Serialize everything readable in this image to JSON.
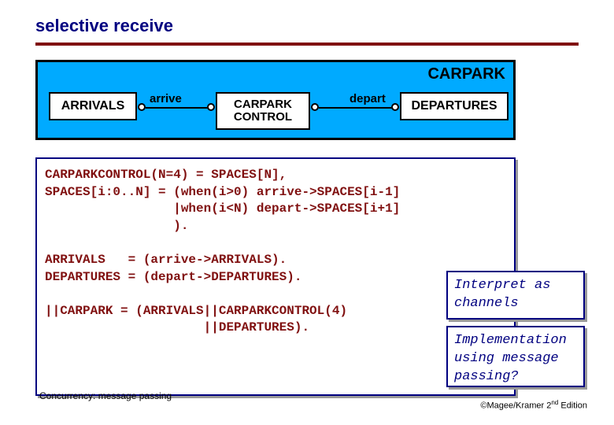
{
  "title": "selective receive",
  "diagram": {
    "system_label": "CARPARK",
    "arrivals": "ARRIVALS",
    "control_l1": "CARPARK",
    "control_l2": "CONTROL",
    "departures": "DEPARTURES",
    "arrive": "arrive",
    "depart": "depart"
  },
  "code": {
    "l1": "CARPARKCONTROL(N=4) = SPACES[N],",
    "l2": "SPACES[i:0..N] = (when(i>0) arrive->SPACES[i-1]",
    "l3": "                 |when(i<N) depart->SPACES[i+1]",
    "l4": "                 ).",
    "l5": "ARRIVALS   = (arrive->ARRIVALS).",
    "l6": "DEPARTURES = (depart->DEPARTURES).",
    "l7": "||CARPARK = (ARRIVALS||CARPARKCONTROL(4)",
    "l8": "                     ||DEPARTURES)."
  },
  "notes": {
    "n1": "Interpret as channels",
    "n2": "Implementation using message passing?"
  },
  "footer": {
    "left": "Concurrency: message passing",
    "right_pre": "©Magee/Kramer ",
    "right_ed": "2",
    "right_suf": " Edition"
  }
}
